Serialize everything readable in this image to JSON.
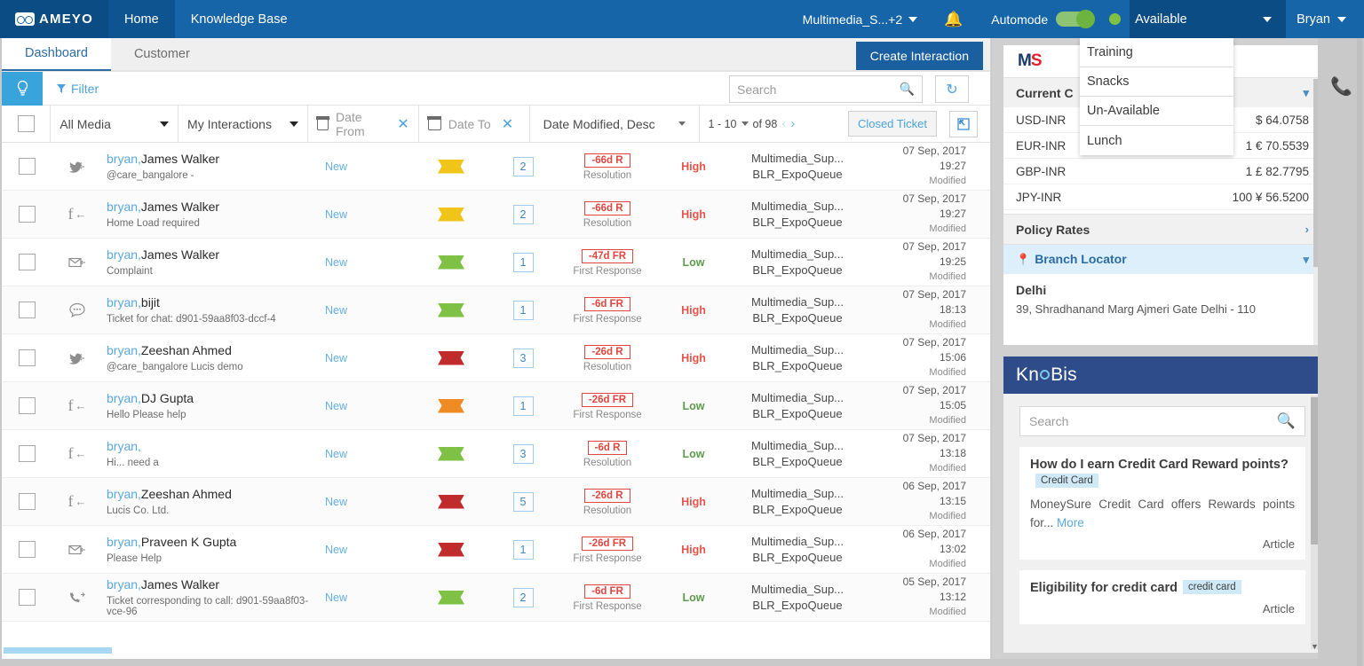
{
  "topnav": {
    "brand": "AMEYO",
    "tabs": [
      {
        "label": "Home",
        "active": true
      },
      {
        "label": "Knowledge Base",
        "active": false
      }
    ],
    "campaign": "Multimedia_S...+2",
    "automode_label": "Automode",
    "status_value": "Available",
    "user": "Bryan",
    "bell_icon": "bell-icon",
    "accent": "#1665a8",
    "accent_dark": "#0c4c84",
    "toggle_on_color": "#6db33f"
  },
  "status_menu": {
    "items": [
      "Training",
      "Snacks",
      "Un-Available",
      "Lunch"
    ]
  },
  "subtabs": {
    "items": [
      {
        "label": "Dashboard",
        "active": true
      },
      {
        "label": "Customer",
        "active": false
      }
    ],
    "create_button": "Create Interaction"
  },
  "filterbar": {
    "bulb_icon": "lightbulb-icon",
    "filter_label": "Filter",
    "search_placeholder": "Search",
    "search_value": "",
    "search_icon": "search-icon",
    "refresh_icon": "refresh-icon"
  },
  "toolbar": {
    "media_filter": "All Media",
    "interaction_filter": "My Interactions",
    "date_from_placeholder": "Date From",
    "date_to_placeholder": "Date To",
    "sort": "Date Modified, Desc",
    "page_range": "1 - 10",
    "page_total": "of 98",
    "closed_ticket": "Closed Ticket",
    "expand_icon": "external-link-icon"
  },
  "table": {
    "rows": [
      {
        "channel_icon": "twitter-inbound-icon",
        "owner": "bryan,",
        "customer": "James Walker",
        "subject": "@care_bangalore -",
        "state": "New",
        "flag_color": "#f0c419",
        "count": "2",
        "sla": "-66d R",
        "sla_label": "Resolution",
        "priority": "High",
        "queue_line1": "Multimedia_Sup...",
        "queue_line2": "BLR_ExpoQueue",
        "date": "07 Sep, 2017",
        "time": "19:27",
        "modified": "Modified"
      },
      {
        "channel_icon": "facebook-inbound-icon",
        "owner": "bryan,",
        "customer": "James Walker",
        "subject": "Home Load required",
        "state": "New",
        "flag_color": "#f0c419",
        "count": "2",
        "sla": "-66d R",
        "sla_label": "Resolution",
        "priority": "High",
        "queue_line1": "Multimedia_Sup...",
        "queue_line2": "BLR_ExpoQueue",
        "date": "07 Sep, 2017",
        "time": "19:27",
        "modified": "Modified"
      },
      {
        "channel_icon": "email-inbound-icon",
        "owner": "bryan,",
        "customer": "James Walker",
        "subject": "Complaint",
        "state": "New",
        "flag_color": "#7ec144",
        "count": "1",
        "sla": "-47d FR",
        "sla_label": "First Response",
        "priority": "Low",
        "queue_line1": "Multimedia_Sup...",
        "queue_line2": "BLR_ExpoQueue",
        "date": "07 Sep, 2017",
        "time": "19:25",
        "modified": "Modified"
      },
      {
        "channel_icon": "chat-inbound-icon",
        "owner": "bryan,",
        "customer": "bijit",
        "subject": "Ticket for chat: d901-59aa8f03-dccf-4",
        "state": "New",
        "flag_color": "#7ec144",
        "count": "1",
        "sla": "-6d FR",
        "sla_label": "First Response",
        "priority": "High",
        "queue_line1": "Multimedia_Sup...",
        "queue_line2": "BLR_ExpoQueue",
        "date": "07 Sep, 2017",
        "time": "18:13",
        "modified": "Modified"
      },
      {
        "channel_icon": "twitter-inbound-icon",
        "owner": "bryan,",
        "customer": "Zeeshan Ahmed",
        "subject": "@care_bangalore Lucis demo",
        "state": "New",
        "flag_color": "#c02b2b",
        "count": "3",
        "sla": "-26d R",
        "sla_label": "Resolution",
        "priority": "High",
        "queue_line1": "Multimedia_Sup...",
        "queue_line2": "BLR_ExpoQueue",
        "date": "07 Sep, 2017",
        "time": "15:06",
        "modified": "Modified"
      },
      {
        "channel_icon": "facebook-inbound-icon",
        "owner": "bryan,",
        "customer": "DJ Gupta",
        "subject": "Hello Please help",
        "state": "New",
        "flag_color": "#ef8b22",
        "count": "1",
        "sla": "-26d FR",
        "sla_label": "First Response",
        "priority": "Low",
        "queue_line1": "Multimedia_Sup...",
        "queue_line2": "BLR_ExpoQueue",
        "date": "07 Sep, 2017",
        "time": "15:05",
        "modified": "Modified"
      },
      {
        "channel_icon": "facebook-inbound-icon",
        "owner": "bryan,",
        "customer": "",
        "subject": "Hi... need a",
        "state": "New",
        "flag_color": "#7ec144",
        "count": "3",
        "sla": "-6d R",
        "sla_label": "Resolution",
        "priority": "Low",
        "queue_line1": "Multimedia_Sup...",
        "queue_line2": "BLR_ExpoQueue",
        "date": "07 Sep, 2017",
        "time": "13:18",
        "modified": "Modified"
      },
      {
        "channel_icon": "facebook-inbound-icon",
        "owner": "bryan,",
        "customer": "Zeeshan Ahmed",
        "subject": "Lucis Co. Ltd.",
        "state": "New",
        "flag_color": "#c02b2b",
        "count": "5",
        "sla": "-26d R",
        "sla_label": "Resolution",
        "priority": "High",
        "queue_line1": "Multimedia_Sup...",
        "queue_line2": "BLR_ExpoQueue",
        "date": "06 Sep, 2017",
        "time": "13:15",
        "modified": "Modified"
      },
      {
        "channel_icon": "email-inbound-icon",
        "owner": "bryan,",
        "customer": "Praveen K Gupta",
        "subject": "Please Help",
        "state": "New",
        "flag_color": "#c02b2b",
        "count": "1",
        "sla": "-26d FR",
        "sla_label": "First Response",
        "priority": "High",
        "queue_line1": "Multimedia_Sup...",
        "queue_line2": "BLR_ExpoQueue",
        "date": "06 Sep, 2017",
        "time": "13:02",
        "modified": "Modified"
      },
      {
        "channel_icon": "call-inbound-icon",
        "owner": "bryan,",
        "customer": "James Walker",
        "subject": "Ticket corresponding to call: d901-59aa8f03-vce-96",
        "state": "New",
        "flag_color": "#7ec144",
        "count": "2",
        "sla": "-6d FR",
        "sla_label": "First Response",
        "priority": "Low",
        "queue_line1": "Multimedia_Sup...",
        "queue_line2": "BLR_ExpoQueue",
        "date": "05 Sep, 2017",
        "time": "13:12",
        "modified": "Modified"
      }
    ]
  },
  "right_panel": {
    "brand_m": "M",
    "brand_s": "S",
    "currency_section": "Current C",
    "rates": [
      {
        "pair": "USD-INR",
        "value": "$ 64.0758"
      },
      {
        "pair": "EUR-INR",
        "value": "1 € 70.5539"
      },
      {
        "pair": "GBP-INR",
        "value": "1 £ 82.7795"
      },
      {
        "pair": "JPY-INR",
        "value": "100 ¥ 56.5200"
      }
    ],
    "policy_rates": "Policy Rates",
    "branch_locator": "Branch Locator",
    "branch_city": "Delhi",
    "branch_address": "39, Shradhanand Marg Ajmeri Gate Delhi - 110"
  },
  "knobis": {
    "title_a": "Kn",
    "title_b": "Bis",
    "search_placeholder": "Search",
    "search_value": "",
    "articles": [
      {
        "question": "How do I earn Credit Card Reward points?",
        "tag": "Credit Card",
        "body": "MoneySure Credit Card offers Rewards points for...",
        "more": "More",
        "type": "Article"
      },
      {
        "question": "Eligibility for credit card",
        "tag": "credit card",
        "body": "",
        "more": "",
        "type": "Article"
      }
    ]
  },
  "right_rail": {
    "phone_icon": "phone-icon"
  }
}
